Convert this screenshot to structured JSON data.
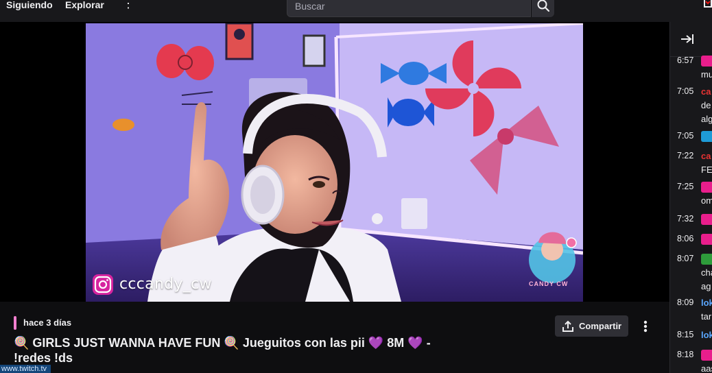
{
  "nav": {
    "following": "Siguiendo",
    "explore": "Explorar"
  },
  "search": {
    "placeholder": "Buscar"
  },
  "video": {
    "overlay_handle": "cccandy_cw",
    "overlay_logo_text": "CANDY CW"
  },
  "stream_info": {
    "date": "hace 3 días",
    "title": "🍭 GIRLS JUST WANNA HAVE FUN 🍭 Jueguitos con las pii 💜 8M 💜 - !redes !ds",
    "share_label": "Compartir"
  },
  "status_url": "www.twitch.tv",
  "chat": {
    "messages": [
      {
        "time": "6:57",
        "badge": "heart-badge",
        "name": "",
        "text": "mu"
      },
      {
        "time": "7:05",
        "badge": "",
        "name": "ca",
        "text": "de",
        "text2": "alg"
      },
      {
        "time": "7:05",
        "badge": "crown-badge",
        "name": "",
        "text": ""
      },
      {
        "time": "7:22",
        "badge": "",
        "name": "ca",
        "text": "FE"
      },
      {
        "time": "7:25",
        "badge": "heart-badge",
        "name": "",
        "text": "om"
      },
      {
        "time": "7:32",
        "badge": "heart-badge",
        "name": "",
        "text": ""
      },
      {
        "time": "8:06",
        "badge": "heart-badge",
        "name": "",
        "text": ""
      },
      {
        "time": "8:07",
        "badge": "sword-badge",
        "name": "",
        "text": "cha",
        "text2": "ag"
      },
      {
        "time": "8:09",
        "badge": "",
        "name": "lok",
        "text": "tar"
      },
      {
        "time": "8:15",
        "badge": "",
        "name": "lok",
        "text": ""
      },
      {
        "time": "8:18",
        "badge": "heart-badge",
        "name": "",
        "text": "aas"
      }
    ]
  },
  "colors": {
    "accent": "#f27fcf",
    "heart_badge": "#e91e8c",
    "crown_badge": "#1e9bd7",
    "sword_badge": "#2e9c3b",
    "name_red": "#e83333",
    "name_blue": "#5aa7ff"
  }
}
